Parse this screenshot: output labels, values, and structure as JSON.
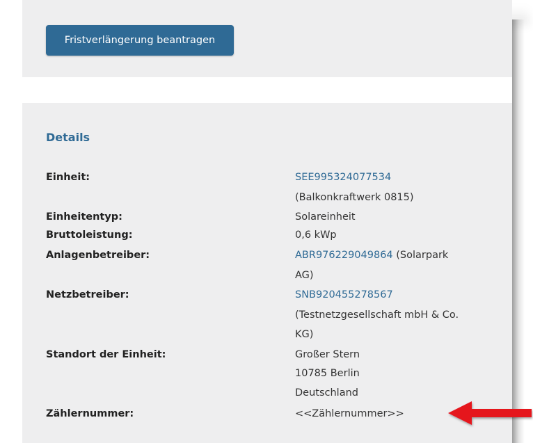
{
  "actions": {
    "extension_button": "Fristverlängerung beantragen"
  },
  "details": {
    "heading": "Details",
    "unit_label": "Einheit:",
    "unit_id": "SEE995324077534",
    "unit_name": "(Balkonkraftwerk 0815)",
    "unit_type_label": "Einheitentyp:",
    "unit_type_value": "Solareinheit",
    "gross_power_label": "Bruttoleistung:",
    "gross_power_value": "0,6 kWp",
    "operator_label": "Anlagenbetreiber:",
    "operator_id": "ABR976229049864",
    "operator_name_part1": " (Solarpark",
    "operator_name_part2": "AG)",
    "grid_operator_label": "Netzbetreiber:",
    "grid_operator_id": "SNB920455278567",
    "grid_operator_name_part1": "(Testnetzgesellschaft mbH & Co.",
    "grid_operator_name_part2": "KG)",
    "location_label": "Standort der Einheit:",
    "location_street": "Großer Stern",
    "location_city": "10785 Berlin",
    "location_country": "Deutschland",
    "meter_label": "Zählernummer:",
    "meter_value": "<<Zählernummer>>"
  },
  "colors": {
    "accent": "#2f6a95",
    "panel_bg": "#eeeeef",
    "annotation_arrow": "#e5161f"
  },
  "icons": {
    "annotation": "red-arrow-left-icon"
  }
}
